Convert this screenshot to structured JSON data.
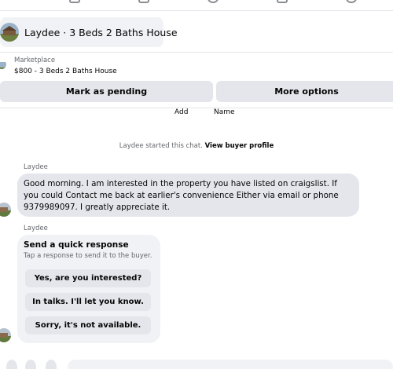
{
  "header": {
    "title": "Laydee · 3 Beds 2 Baths House"
  },
  "listing": {
    "section_label": "Marketplace",
    "summary": "$800 - 3 Beds 2 Baths House"
  },
  "actions": {
    "mark_pending": "Mark as pending",
    "more_options": "More options"
  },
  "add_name": {
    "add": "Add",
    "name": "Name"
  },
  "chat_status": {
    "text": "Laydee started this chat. ",
    "link": "View buyer profile"
  },
  "messages": [
    {
      "sender": "Laydee",
      "text": "Good morning. I am interested in the property you have listed on craigslist. If you could Contact me back at earlier's convenience Either via email or phone 9379989097. I greatly appreciate it."
    },
    {
      "sender": "Laydee"
    }
  ],
  "quick_response": {
    "title": "Send a quick response",
    "subtitle": "Tap a response to send it to the buyer.",
    "options": [
      "Yes, are you interested?",
      "In talks. I'll let you know.",
      "Sorry, it's not available."
    ]
  },
  "colors": {
    "bubble": "#e4e6eb",
    "card": "#f0f2f5",
    "muted_text": "#65676b"
  }
}
